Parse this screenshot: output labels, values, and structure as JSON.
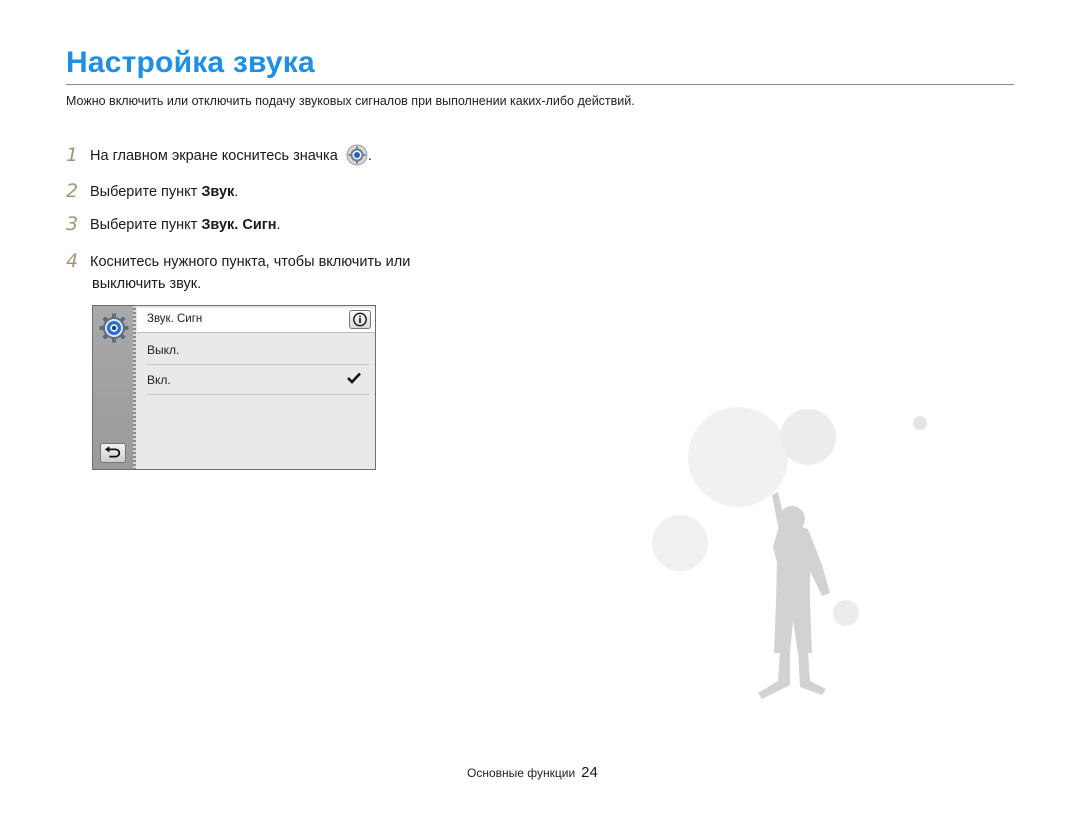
{
  "title": "Настройка звука",
  "intro": "Можно включить или отключить подачу звуковых сигналов при выполнении каких-либо действий.",
  "steps": [
    {
      "num": "1",
      "text": "На главном экране коснитесь значка",
      "suffix": "."
    },
    {
      "num": "2",
      "text": "Выберите пункт ",
      "bold": "Звук",
      "suffix": "."
    },
    {
      "num": "3",
      "text": "Выберите пункт ",
      "bold": "Звук. Сигн",
      "suffix": "."
    },
    {
      "num": "4",
      "text": "Коснитесь нужного пункта, чтобы включить или",
      "cont": "выключить звук."
    }
  ],
  "screen": {
    "header": "Звук. Сигн",
    "items": [
      {
        "label": "Выкл.",
        "checked": false
      },
      {
        "label": "Вкл.",
        "checked": true
      }
    ],
    "icons": {
      "settings": "gear-icon",
      "info": "info-icon",
      "back": "back-arrow-icon",
      "check": "checkmark-icon"
    }
  },
  "footer": {
    "section": "Основные функции",
    "page": "24"
  },
  "colors": {
    "title": "#1e8fe6",
    "step_number": "#a8927a"
  }
}
